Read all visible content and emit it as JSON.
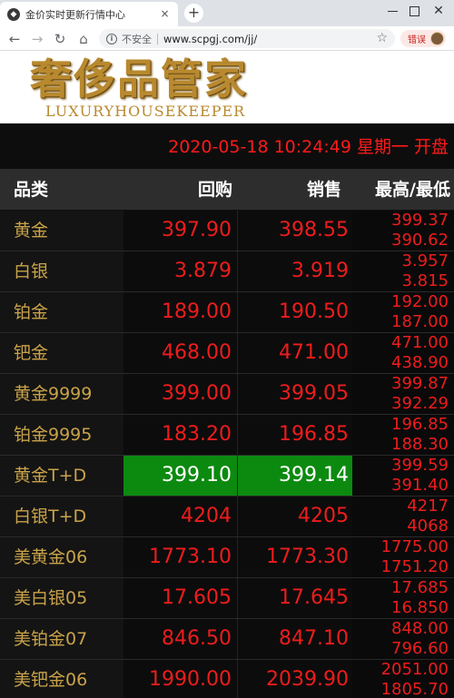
{
  "browser": {
    "tab_title": "金价实时更新行情中心",
    "close_glyph": "×",
    "newtab_glyph": "+",
    "insecure_label": "不安全",
    "url": "www.scpgj.com/jj/",
    "error_label": "错误"
  },
  "site": {
    "logo_cn": "奢侈品管家",
    "logo_en": "LUXURYHOUSEKEEPER"
  },
  "status": {
    "datetime": "2020-05-18 10:24:49 星期一  开盘"
  },
  "columns": {
    "category": "品类",
    "buy": "回购",
    "sell": "销售",
    "high_low": "最高/最低"
  },
  "colors": {
    "price_red": "#ee1c1c",
    "name_gold": "#c9a34a",
    "highlight_green": "#0c8a10"
  },
  "rows": [
    {
      "name": "黄金",
      "buy": "397.90",
      "sell": "398.55",
      "high": "399.37",
      "low": "390.62",
      "highlight": false
    },
    {
      "name": "白银",
      "buy": "3.879",
      "sell": "3.919",
      "high": "3.957",
      "low": "3.815",
      "highlight": false
    },
    {
      "name": "铂金",
      "buy": "189.00",
      "sell": "190.50",
      "high": "192.00",
      "low": "187.00",
      "highlight": false
    },
    {
      "name": "钯金",
      "buy": "468.00",
      "sell": "471.00",
      "high": "471.00",
      "low": "438.90",
      "highlight": false
    },
    {
      "name": "黄金9999",
      "buy": "399.00",
      "sell": "399.05",
      "high": "399.87",
      "low": "392.29",
      "highlight": false
    },
    {
      "name": "铂金9995",
      "buy": "183.20",
      "sell": "196.85",
      "high": "196.85",
      "low": "188.30",
      "highlight": false
    },
    {
      "name": "黄金T+D",
      "buy": "399.10",
      "sell": "399.14",
      "high": "399.59",
      "low": "391.40",
      "highlight": true
    },
    {
      "name": "白银T+D",
      "buy": "4204",
      "sell": "4205",
      "high": "4217",
      "low": "4068",
      "highlight": false
    },
    {
      "name": "美黄金06",
      "buy": "1773.10",
      "sell": "1773.30",
      "high": "1775.00",
      "low": "1751.20",
      "highlight": false
    },
    {
      "name": "美白银05",
      "buy": "17.605",
      "sell": "17.645",
      "high": "17.685",
      "low": "16.850",
      "highlight": false
    },
    {
      "name": "美铂金07",
      "buy": "846.50",
      "sell": "847.10",
      "high": "848.00",
      "low": "796.60",
      "highlight": false
    },
    {
      "name": "美钯金06",
      "buy": "1990.00",
      "sell": "2039.90",
      "high": "2051.00",
      "low": "1805.70",
      "highlight": false
    }
  ]
}
